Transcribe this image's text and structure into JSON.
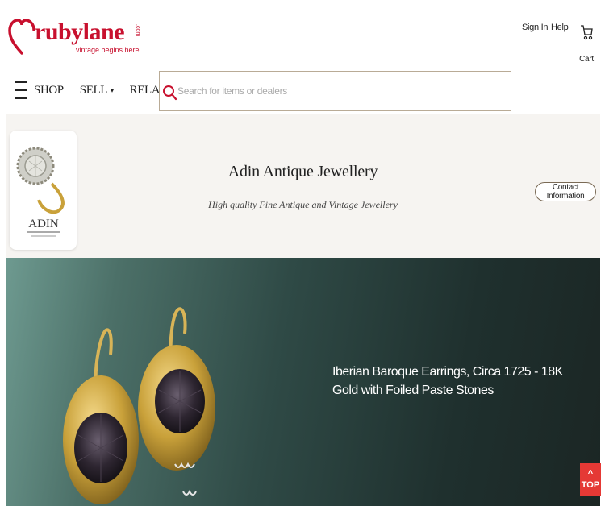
{
  "header": {
    "logo": {
      "wordmark": "rubylane",
      "com": ".com",
      "tagline": "vintage begins here"
    },
    "links": {
      "sign_in": "Sign In",
      "help": "Help",
      "cart": "Cart"
    }
  },
  "nav": {
    "menu_icon": "hamburger-menu-icon",
    "shop": "SHOP",
    "sell": "SELL",
    "relax": "RELAX",
    "caret": "▾"
  },
  "search": {
    "icon": "search-icon",
    "value": "",
    "placeholder": "Search for items or dealers"
  },
  "shop": {
    "name": "Adin Antique Jewellery",
    "tagline": "High quality Fine Antique and Vintage Jewellery",
    "logo_lettering": "ADIN",
    "contact_label": "Contact Information"
  },
  "hero": {
    "title": "Iberian Baroque Earrings, Circa 1725 - 18K Gold with Foiled Paste Stones"
  },
  "back_to_top": {
    "arrow": "^",
    "label": "TOP"
  },
  "colors": {
    "brand_red": "#c8102e",
    "top_button": "#e53935",
    "search_border": "#b9ab96",
    "banner_bg": "#f6f4f1"
  }
}
